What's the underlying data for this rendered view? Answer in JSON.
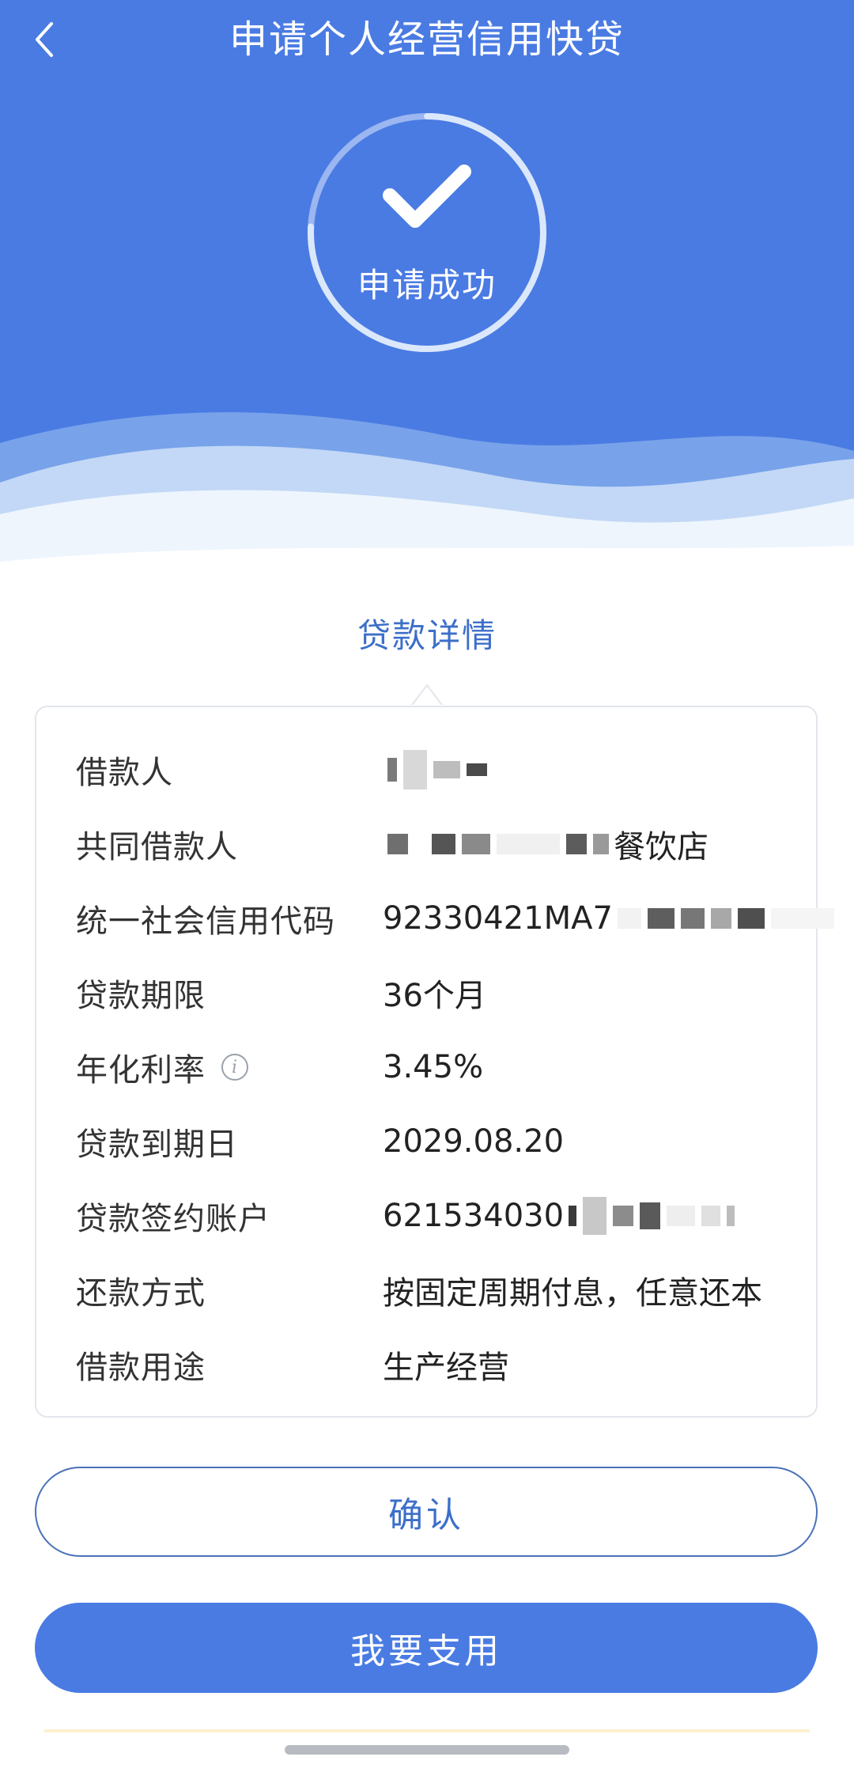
{
  "header": {
    "title": "申请个人经营信用快贷",
    "back_icon": "chevron-left-icon"
  },
  "status": {
    "icon": "check-icon",
    "text": "申请成功"
  },
  "details": {
    "section_title": "贷款详情",
    "rows": [
      {
        "label": "借款人",
        "value": ""
      },
      {
        "label": "共同借款人",
        "value": "餐饮店"
      },
      {
        "label": "统一社会信用代码",
        "value": "92330421MA7"
      },
      {
        "label": "贷款期限",
        "value": "36个月"
      },
      {
        "label": "年化利率",
        "value": "3.45%"
      },
      {
        "label": "贷款到期日",
        "value": "2029.08.20"
      },
      {
        "label": "贷款签约账户",
        "value": "621534030"
      },
      {
        "label": "还款方式",
        "value": "按固定周期付息，任意还本"
      },
      {
        "label": "借款用途",
        "value": "生产经营"
      }
    ],
    "info_icon": "info-icon"
  },
  "buttons": {
    "confirm": "确认",
    "use": "我要支用"
  },
  "colors": {
    "brand": "#4a7be3",
    "accent_text": "#3d6fc9"
  }
}
